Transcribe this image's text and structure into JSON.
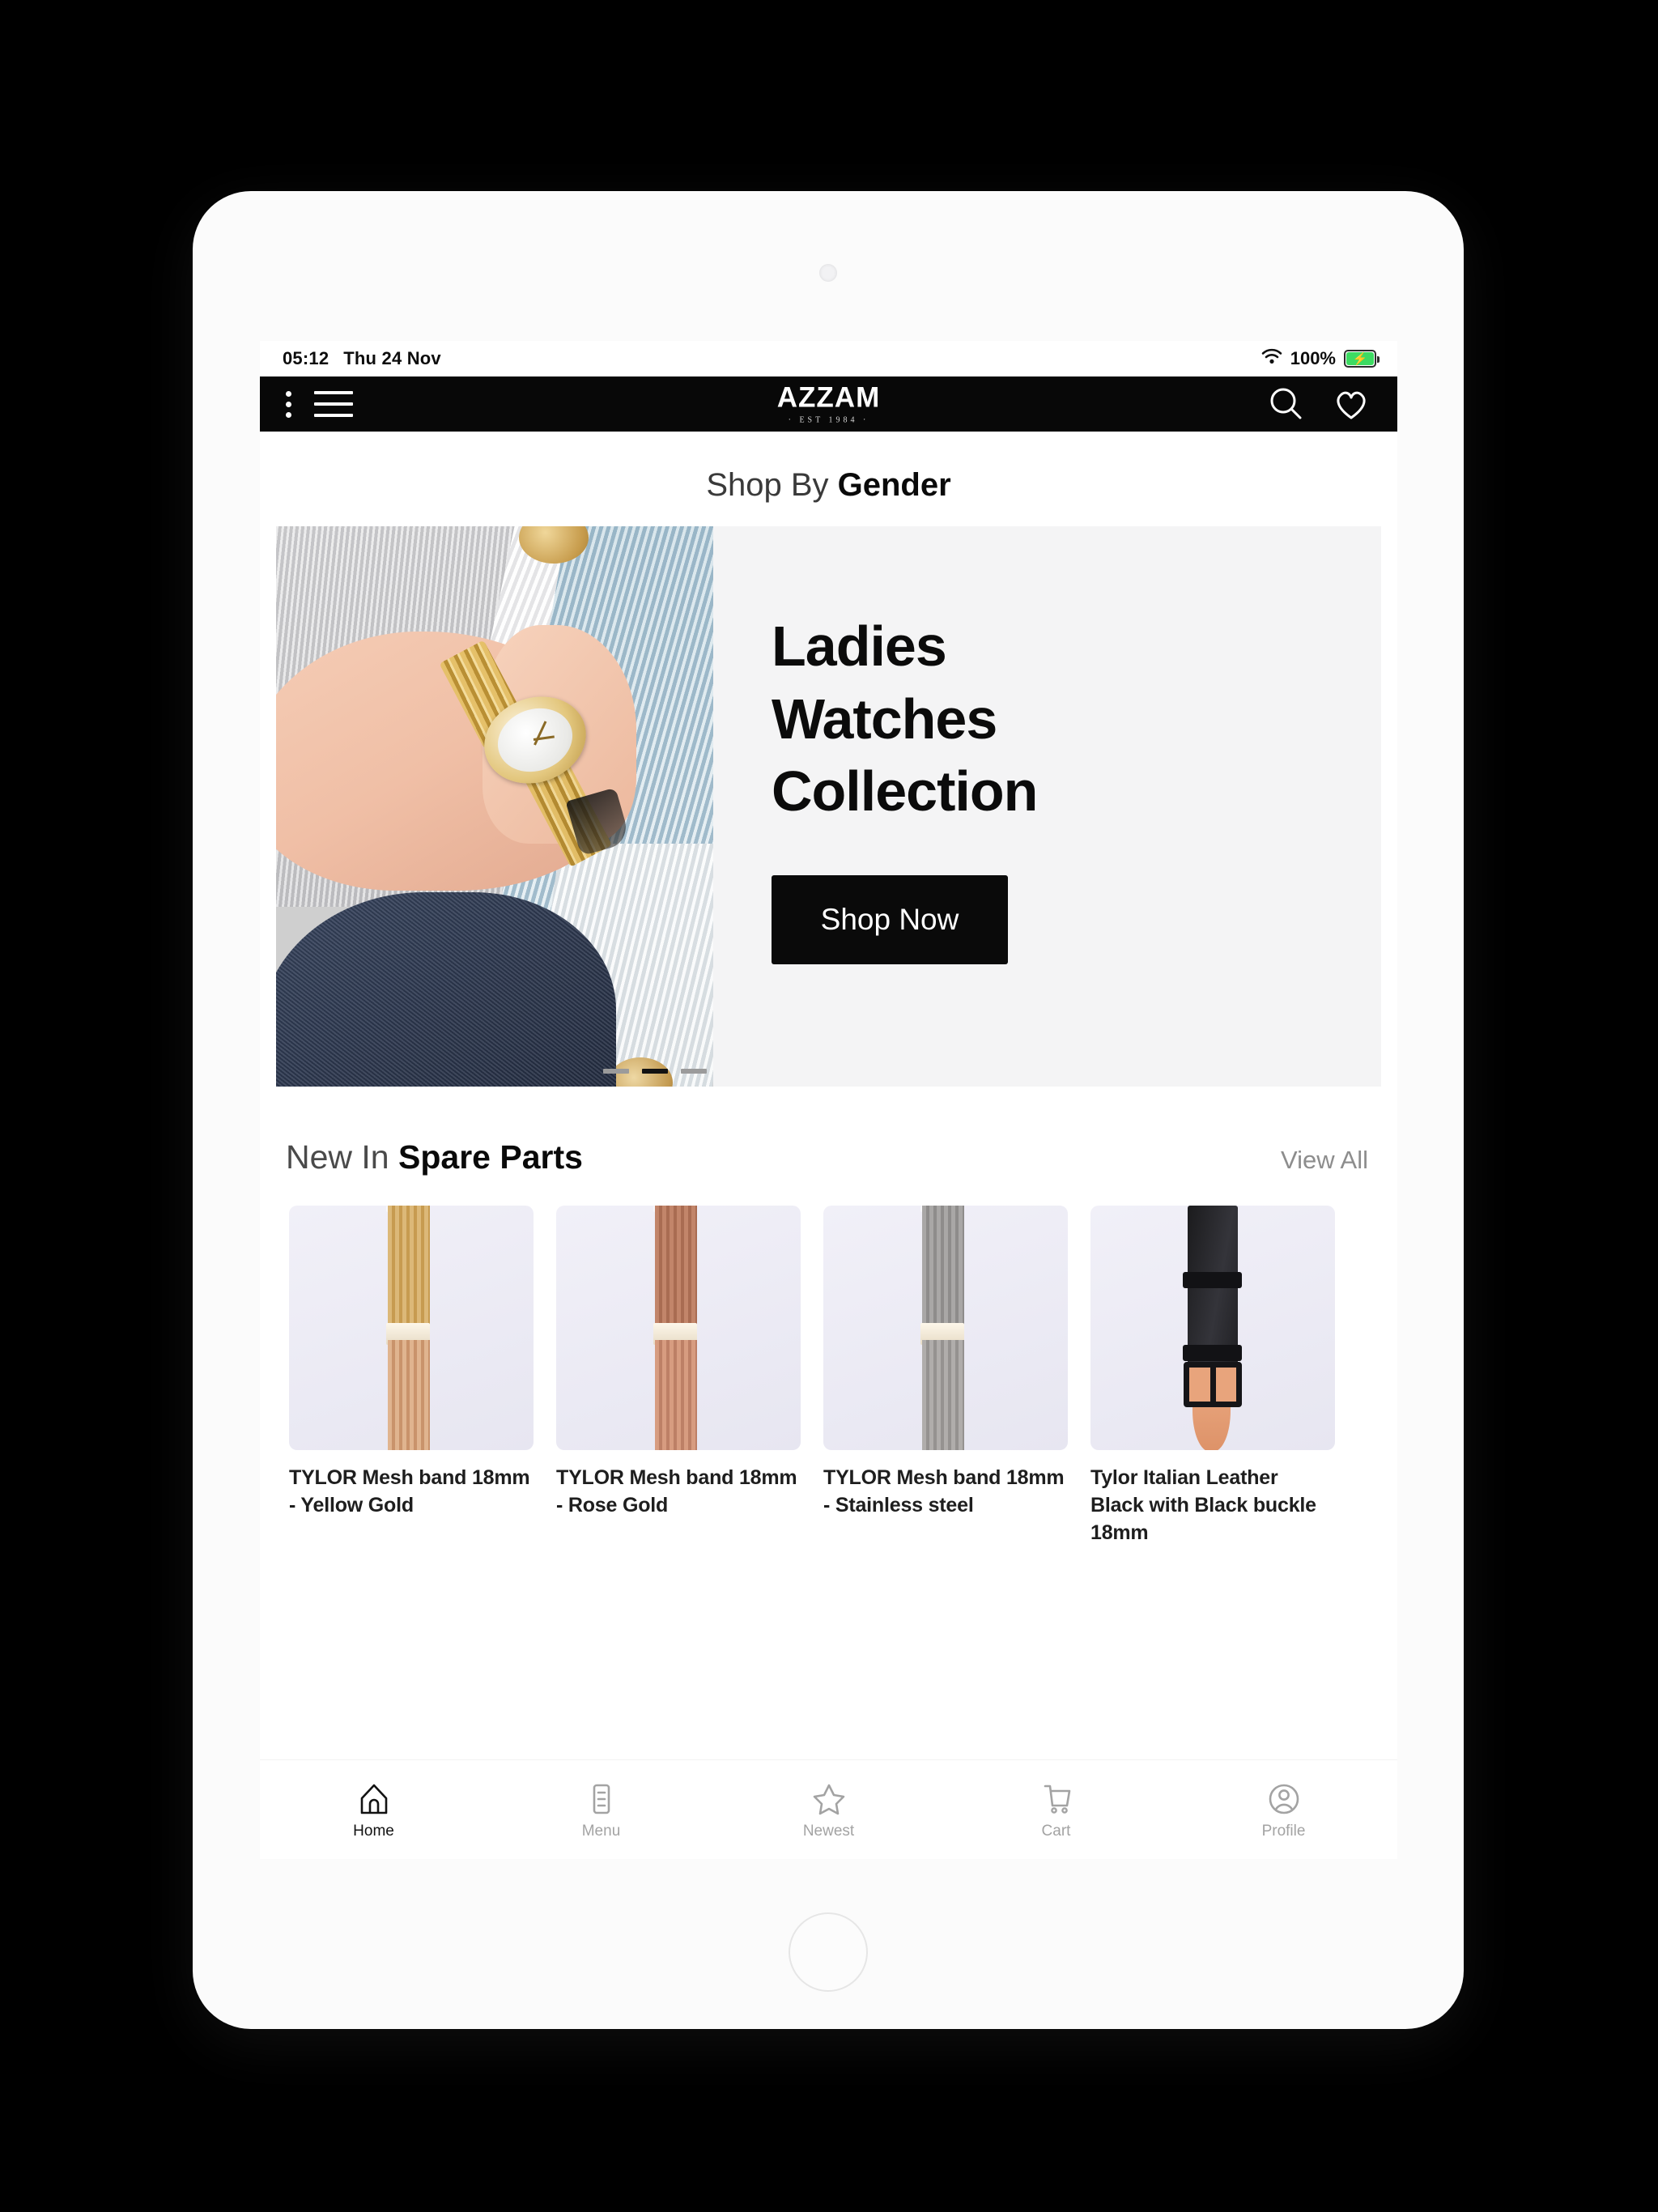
{
  "status_bar": {
    "time": "05:12",
    "date": "Thu 24 Nov",
    "battery_percent": "100%",
    "wifi_icon": "wifi-icon",
    "battery_icon": "battery-charging-icon"
  },
  "header": {
    "kebab_icon": "more-vertical-icon",
    "menu_icon": "hamburger-menu-icon",
    "brand_name": "AZZAM",
    "brand_tagline": "· EST 1984 ·",
    "search_icon": "search-icon",
    "wishlist_icon": "heart-icon"
  },
  "gender_section": {
    "title_light": "Shop By ",
    "title_bold": "Gender"
  },
  "hero": {
    "title_line1": "Ladies",
    "title_line2": "Watches",
    "title_line3": "Collection",
    "cta_label": "Shop Now",
    "slide_count": 3,
    "active_slide": 2,
    "accent_color": "#0a0a0a",
    "panel_color": "#f4f4f5"
  },
  "spare_parts": {
    "title_light": "New In ",
    "title_bold": "Spare Parts",
    "view_all_label": "View All",
    "products": [
      {
        "name": "TYLOR Mesh band 18mm - Yellow Gold",
        "swatch": "gold-mesh"
      },
      {
        "name": "TYLOR Mesh band 18mm - Rose Gold",
        "swatch": "rose-mesh"
      },
      {
        "name": "TYLOR Mesh band 18mm - Stainless steel",
        "swatch": "steel-mesh"
      },
      {
        "name": "Tylor Italian Leather Black with Black buckle 18mm",
        "swatch": "black-leather"
      }
    ]
  },
  "bottom_nav": {
    "items": [
      {
        "label": "Home",
        "icon": "home-icon",
        "active": true
      },
      {
        "label": "Menu",
        "icon": "list-icon",
        "active": false
      },
      {
        "label": "Newest",
        "icon": "star-icon",
        "active": false
      },
      {
        "label": "Cart",
        "icon": "cart-icon",
        "active": false
      },
      {
        "label": "Profile",
        "icon": "user-icon",
        "active": false
      }
    ]
  }
}
